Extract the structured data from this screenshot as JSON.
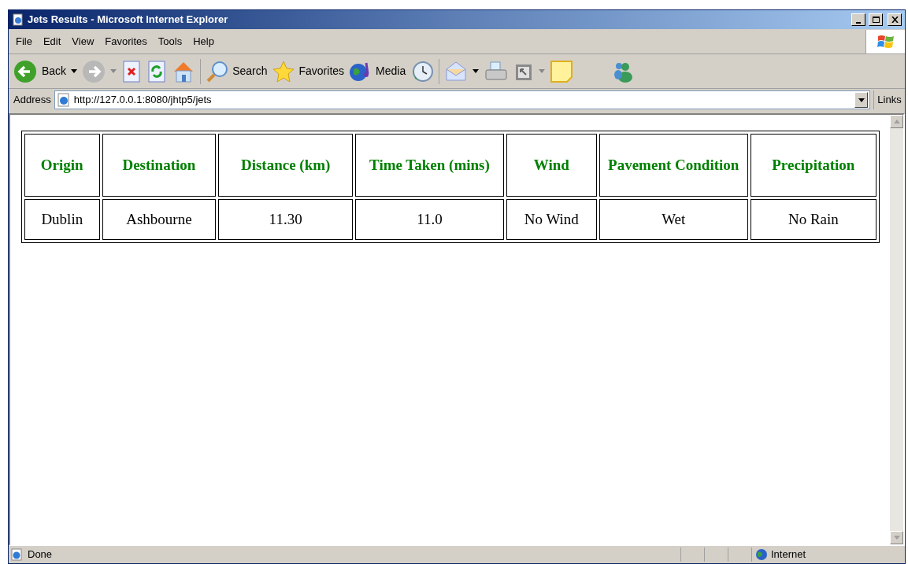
{
  "window": {
    "title": "Jets Results - Microsoft Internet Explorer"
  },
  "menu": [
    "File",
    "Edit",
    "View",
    "Favorites",
    "Tools",
    "Help"
  ],
  "toolbar": {
    "back": "Back",
    "search": "Search",
    "favorites": "Favorites",
    "media": "Media"
  },
  "address_bar": {
    "label": "Address",
    "url": "http://127.0.0.1:8080/jhtp5/jets",
    "links": "Links"
  },
  "table": {
    "columns": [
      "Origin",
      "Destination",
      "Distance (km)",
      "Time Taken (mins)",
      "Wind",
      "Pavement Condition",
      "Precipitation"
    ],
    "rows": [
      [
        "Dublin",
        "Ashbourne",
        "11.30",
        "11.0",
        "No Wind",
        "Wet",
        "No Rain"
      ]
    ]
  },
  "status_bar": {
    "text": "Done",
    "zone": "Internet"
  }
}
